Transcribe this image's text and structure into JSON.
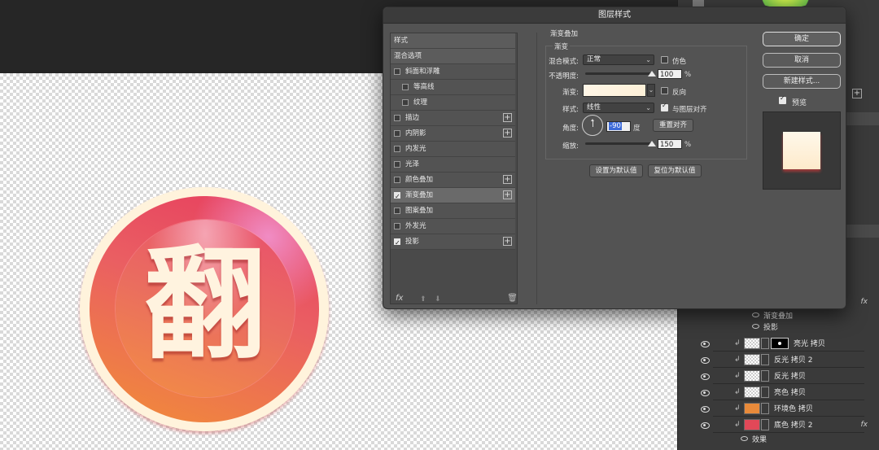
{
  "dialog": {
    "title": "图层样式",
    "style_list": [
      {
        "label": "样式",
        "kind": "header"
      },
      {
        "label": "混合选项",
        "kind": "header"
      },
      {
        "label": "斜面和浮雕",
        "checked": false,
        "plus": false,
        "indent": 0
      },
      {
        "label": "等高线",
        "checked": false,
        "plus": false,
        "indent": 1
      },
      {
        "label": "纹理",
        "checked": false,
        "plus": false,
        "indent": 1
      },
      {
        "label": "描边",
        "checked": false,
        "plus": true,
        "indent": 0
      },
      {
        "label": "内阴影",
        "checked": false,
        "plus": true,
        "indent": 0
      },
      {
        "label": "内发光",
        "checked": false,
        "plus": false,
        "indent": 0
      },
      {
        "label": "光泽",
        "checked": false,
        "plus": false,
        "indent": 0
      },
      {
        "label": "颜色叠加",
        "checked": false,
        "plus": true,
        "indent": 0
      },
      {
        "label": "渐变叠加",
        "checked": true,
        "plus": true,
        "indent": 0,
        "selected": true
      },
      {
        "label": "图案叠加",
        "checked": false,
        "plus": false,
        "indent": 0
      },
      {
        "label": "外发光",
        "checked": false,
        "plus": false,
        "indent": 0
      },
      {
        "label": "投影",
        "checked": true,
        "plus": true,
        "indent": 0
      }
    ],
    "footer": {
      "fx": "fx",
      "up_icon": "arrow-up",
      "down_icon": "arrow-down",
      "trash_icon": "trash"
    },
    "gradient_overlay": {
      "section_title": "渐变叠加",
      "sub_title": "渐变",
      "blend_mode_label": "混合模式:",
      "blend_mode_value": "正常",
      "dither_label": "仿色",
      "dither_checked": false,
      "opacity_label": "不透明度:",
      "opacity_value": "100",
      "opacity_unit": "%",
      "opacity_level": 1.0,
      "gradient_label": "渐变:",
      "gradient_colors": [
        "#fff6e6",
        "#fdf0d8"
      ],
      "reverse_label": "反向",
      "reverse_checked": false,
      "style_label": "样式:",
      "style_value": "线性",
      "align_label": "与图层对齐",
      "align_checked": true,
      "angle_label": "角度:",
      "angle_value": "-90",
      "angle_unit": "度",
      "reset_align_label": "重置对齐",
      "scale_label": "缩放:",
      "scale_value": "150",
      "scale_unit": "%",
      "scale_level": 1.0,
      "make_default_label": "设置为默认值",
      "reset_default_label": "复位为默认值"
    },
    "buttons": {
      "ok": "确定",
      "cancel": "取消",
      "new_style": "新建样式...",
      "preview_label": "预览",
      "preview_checked": true
    }
  },
  "canvas": {
    "badge_char": "翻",
    "colors": {
      "rim": "#fff3dc",
      "top": "#e74360",
      "bottom": "#f0853f",
      "glyph": "#fff3df"
    }
  },
  "layers": {
    "effects_group": {
      "label": "效果",
      "items": [
        "渐变叠加",
        "投影"
      ]
    },
    "rows": [
      {
        "name": "亮光 拷贝",
        "thumb": "checker",
        "mask": true,
        "fx": false
      },
      {
        "name": "反光 拷贝 2",
        "thumb": "checker",
        "mask": false,
        "fx": false
      },
      {
        "name": "反光 拷贝",
        "thumb": "checker",
        "mask": false,
        "fx": false
      },
      {
        "name": "亮色 拷贝",
        "thumb": "checker",
        "mask": false,
        "fx": false
      },
      {
        "name": "环境色 拷贝",
        "thumb": "orange",
        "mask": false,
        "fx": false
      },
      {
        "name": "底色 拷贝 2",
        "thumb": "red",
        "mask": false,
        "fx": true
      }
    ],
    "bottom_effects_label": "效果",
    "fx_label": "fx"
  }
}
